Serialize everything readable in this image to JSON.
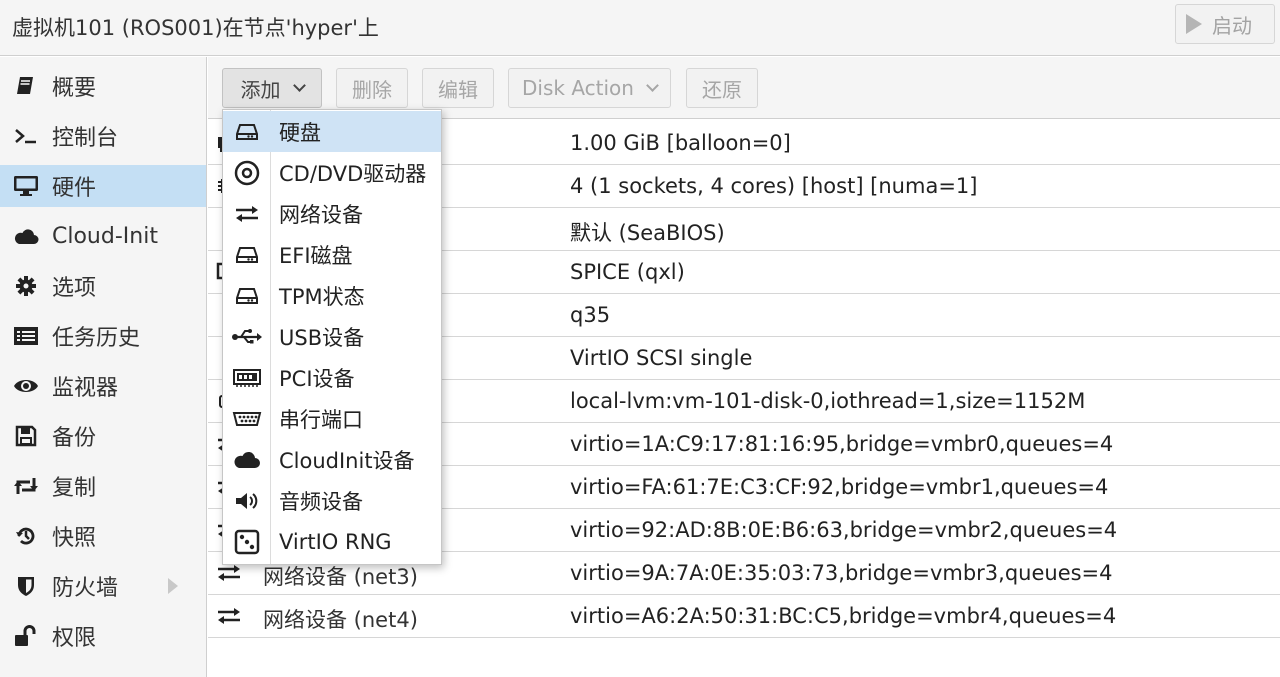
{
  "window": {
    "title": "虚拟机101 (ROS001)在节点'hyper'上",
    "start_label": "启动"
  },
  "sidebar": {
    "items": [
      {
        "label": "概要",
        "icon": "book-icon"
      },
      {
        "label": "控制台",
        "icon": "terminal-icon"
      },
      {
        "label": "硬件",
        "icon": "monitor-icon",
        "active": true
      },
      {
        "label": "Cloud-Init",
        "icon": "cloud-icon"
      },
      {
        "label": "选项",
        "icon": "gear-icon"
      },
      {
        "label": "任务历史",
        "icon": "list-icon"
      },
      {
        "label": "监视器",
        "icon": "eye-icon"
      },
      {
        "label": "备份",
        "icon": "floppy-icon"
      },
      {
        "label": "复制",
        "icon": "retweet-icon"
      },
      {
        "label": "快照",
        "icon": "history-icon"
      },
      {
        "label": "防火墙",
        "icon": "shield-icon"
      },
      {
        "label": "权限",
        "icon": "unlock-icon"
      }
    ]
  },
  "toolbar": {
    "add_label": "添加",
    "delete_label": "删除",
    "edit_label": "编辑",
    "disk_action_label": "Disk Action",
    "revert_label": "还原"
  },
  "table": {
    "rows": [
      {
        "name": "",
        "value": "1.00 GiB [balloon=0]",
        "icon": "memory-icon"
      },
      {
        "name": "",
        "value": "4 (1 sockets, 4 cores) [host] [numa=1]",
        "icon": "cpu-icon"
      },
      {
        "name": "",
        "value": "默认 (SeaBIOS)",
        "icon": "bios-icon"
      },
      {
        "name": "",
        "value": "SPICE (qxl)",
        "icon": "display-icon"
      },
      {
        "name": "",
        "value": "q35",
        "icon": "machine-icon"
      },
      {
        "name": "",
        "value": "VirtIO SCSI single",
        "icon": "database-icon"
      },
      {
        "name": "",
        "value": "local-lvm:vm-101-disk-0,iothread=1,size=1152M",
        "icon": "harddisk-icon"
      },
      {
        "name": "",
        "value": "virtio=1A:C9:17:81:16:95,bridge=vmbr0,queues=4",
        "icon": "network-icon"
      },
      {
        "name": "",
        "value": "virtio=FA:61:7E:C3:CF:92,bridge=vmbr1,queues=4",
        "icon": "network-icon"
      },
      {
        "name": "",
        "value": "virtio=92:AD:8B:0E:B6:63,bridge=vmbr2,queues=4",
        "icon": "network-icon"
      },
      {
        "name": "网络设备 (net3)",
        "value": "virtio=9A:7A:0E:35:03:73,bridge=vmbr3,queues=4",
        "icon": "network-icon"
      },
      {
        "name": "网络设备 (net4)",
        "value": "virtio=A6:2A:50:31:BC:C5,bridge=vmbr4,queues=4",
        "icon": "network-icon"
      }
    ]
  },
  "add_menu": {
    "items": [
      {
        "label": "硬盘",
        "icon": "harddisk-icon",
        "hovered": true
      },
      {
        "label": "CD/DVD驱动器",
        "icon": "cdrom-icon"
      },
      {
        "label": "网络设备",
        "icon": "network-icon"
      },
      {
        "label": "EFI磁盘",
        "icon": "harddisk-icon"
      },
      {
        "label": "TPM状态",
        "icon": "harddisk-icon"
      },
      {
        "label": "USB设备",
        "icon": "usb-icon"
      },
      {
        "label": "PCI设备",
        "icon": "pci-card-icon"
      },
      {
        "label": "串行端口",
        "icon": "serial-port-icon"
      },
      {
        "label": "CloudInit设备",
        "icon": "cloud-icon"
      },
      {
        "label": "音频设备",
        "icon": "volume-icon"
      },
      {
        "label": "VirtIO RNG",
        "icon": "dice-icon"
      }
    ]
  }
}
